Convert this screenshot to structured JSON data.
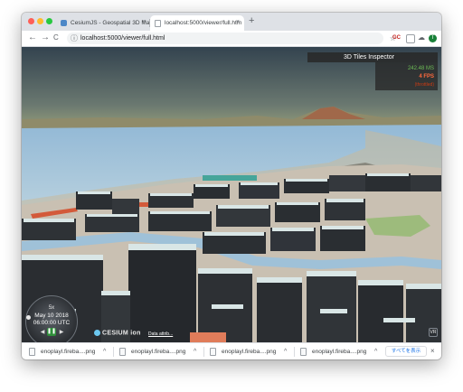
{
  "browser": {
    "tabs": [
      {
        "title": "CesiumJS - Geospatial 3D Ma",
        "close": "×"
      },
      {
        "title": "localhost:5000/viewer/full.htm",
        "close": "×"
      }
    ],
    "new_tab": "+",
    "nav": {
      "back": "←",
      "forward": "→",
      "reload": "C"
    },
    "url": "localhost:5000/viewer/full.html",
    "info_icon": "ⓘ",
    "star": "☆",
    "ext_label": "GC",
    "profile_initial": "T",
    "menu": "⋮"
  },
  "viewer": {
    "inspector_title": "3D Tiles Inspector",
    "perf_ms": "242.48 MS",
    "perf_fps": "4 FPS",
    "perf_throttled": "(throttled)",
    "animation": {
      "speed": "5x",
      "date": "May 10 2018",
      "time": "06:00:00 UTC",
      "rev": "◀",
      "pause": "❚❚",
      "fwd": "▶"
    },
    "logo": "CESIUM ion",
    "data_attribution": "Data attrib...",
    "vr_icon": "VR"
  },
  "downloads": {
    "items": [
      {
        "name": "enoplayl.fireba....png",
        "chevron": "^"
      },
      {
        "name": "enoplayl.fireba....png",
        "chevron": "^"
      },
      {
        "name": "enoplayl.fireba....png",
        "chevron": "^"
      },
      {
        "name": "enoplayl.fireba....png",
        "chevron": "^"
      }
    ],
    "show_all": "すべてを表示",
    "close": "×"
  },
  "colors": {
    "sky_top": "#3a4a5a",
    "sky_bottom": "#7d8a7c",
    "sea": "#a9c7dc",
    "buildings": "#2b2f33",
    "roofs": "#d9e6e6",
    "fps": "#ff6a3d",
    "ms": "#6dbd55"
  }
}
